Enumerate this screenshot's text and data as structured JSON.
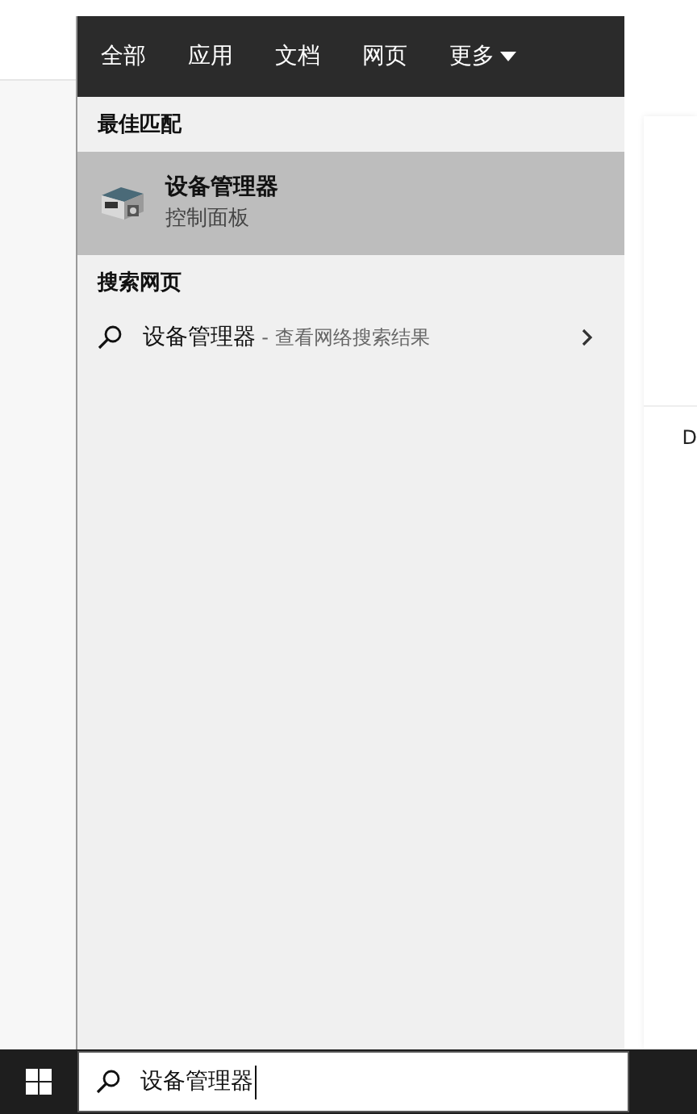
{
  "tabs": [
    {
      "label": "全部"
    },
    {
      "label": "应用"
    },
    {
      "label": "文档"
    },
    {
      "label": "网页"
    },
    {
      "label": "更多",
      "dropdown": true
    }
  ],
  "sections": [
    {
      "heading": "最佳匹配",
      "items": [
        {
          "kind": "app",
          "title": "设备管理器",
          "subtitle": "控制面板",
          "selected": true
        }
      ]
    },
    {
      "heading": "搜索网页",
      "items": [
        {
          "kind": "web",
          "title": "设备管理器",
          "hint": " - 查看网络搜索结果",
          "selected": false
        }
      ]
    }
  ],
  "background": {
    "text": "D"
  },
  "taskbar": {
    "search": {
      "value": "设备管理器"
    }
  }
}
